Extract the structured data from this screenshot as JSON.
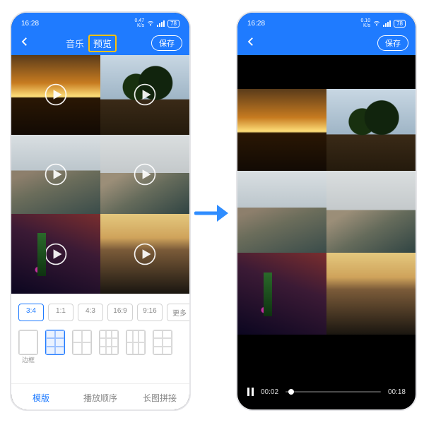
{
  "status": {
    "time": "16:28",
    "netRate": "0.47",
    "netUnit": "K/s",
    "battery": "78"
  },
  "status2": {
    "netRate": "0.10",
    "netUnit": "K/s"
  },
  "nav": {
    "tab_music": "音乐",
    "tab_preview": "预览",
    "save": "保存"
  },
  "ratios": {
    "r34": "3:4",
    "r11": "1:1",
    "r43": "4:3",
    "r169": "16:9",
    "r916": "9:16",
    "more": "更多"
  },
  "layoutLabels": {
    "border": "边框"
  },
  "tabs": {
    "template": "模版",
    "order": "播放顺序",
    "long": "长图拼接"
  },
  "player": {
    "elapsed": "00:02",
    "total": "00:18"
  }
}
